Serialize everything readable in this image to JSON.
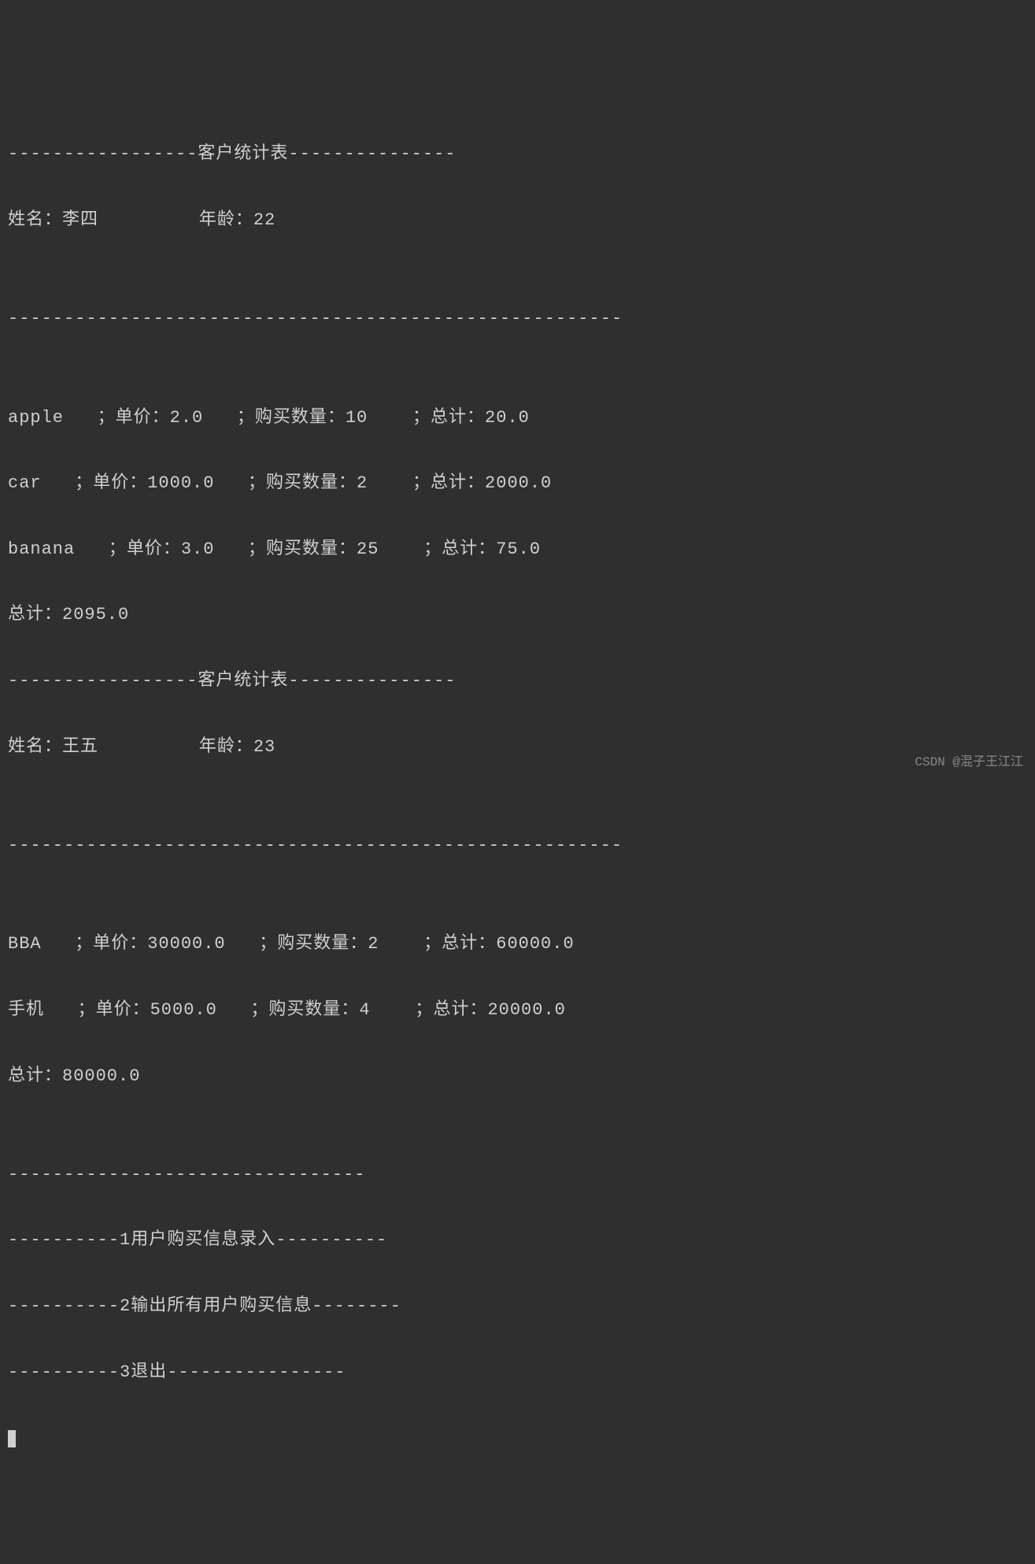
{
  "header_title": "客户统计表",
  "labels": {
    "name": "姓名：",
    "age": "年龄：",
    "unit_price": "单价：",
    "qty": "购买数量：",
    "subtotal": "总计：",
    "total": "总计："
  },
  "customers": [
    {
      "name": "李四",
      "age": "22",
      "items": [
        {
          "product": "apple",
          "price": "2.0",
          "qty": "10",
          "subtotal": "20.0"
        },
        {
          "product": "car",
          "price": "1000.0",
          "qty": "2",
          "subtotal": "2000.0"
        },
        {
          "product": "banana",
          "price": "3.0",
          "qty": "25",
          "subtotal": "75.0"
        }
      ],
      "total": "2095.0"
    },
    {
      "name": "王五",
      "age": "23",
      "items": [
        {
          "product": "BBA",
          "price": "30000.0",
          "qty": "2",
          "subtotal": "60000.0"
        },
        {
          "product": "手机",
          "price": "5000.0",
          "qty": "4",
          "subtotal": "20000.0"
        }
      ],
      "total": "80000.0"
    }
  ],
  "menu": {
    "separator": "--------------------------------",
    "items": [
      "----------1用户购买信息录入----------",
      "----------2输出所有用户购买信息--------",
      "----------3退出----------------"
    ]
  },
  "watermark": "CSDN @混子王江江",
  "formatted_lines": [
    "-----------------客户统计表---------------",
    "姓名：李四         年龄：22",
    "",
    "-------------------------------------------------------",
    "",
    "apple   ；单价：2.0   ；购买数量：10    ；总计：20.0",
    "car   ；单价：1000.0   ；购买数量：2    ；总计：2000.0",
    "banana   ；单价：3.0   ；购买数量：25    ；总计：75.0",
    "总计：2095.0",
    "-----------------客户统计表---------------",
    "姓名：王五         年龄：23",
    "",
    "-------------------------------------------------------",
    "",
    "BBA   ；单价：30000.0   ；购买数量：2    ；总计：60000.0",
    "手机   ；单价：5000.0   ；购买数量：4    ；总计：20000.0",
    "总计：80000.0",
    "",
    "--------------------------------",
    "----------1用户购买信息录入----------",
    "----------2输出所有用户购买信息--------",
    "----------3退出----------------"
  ]
}
